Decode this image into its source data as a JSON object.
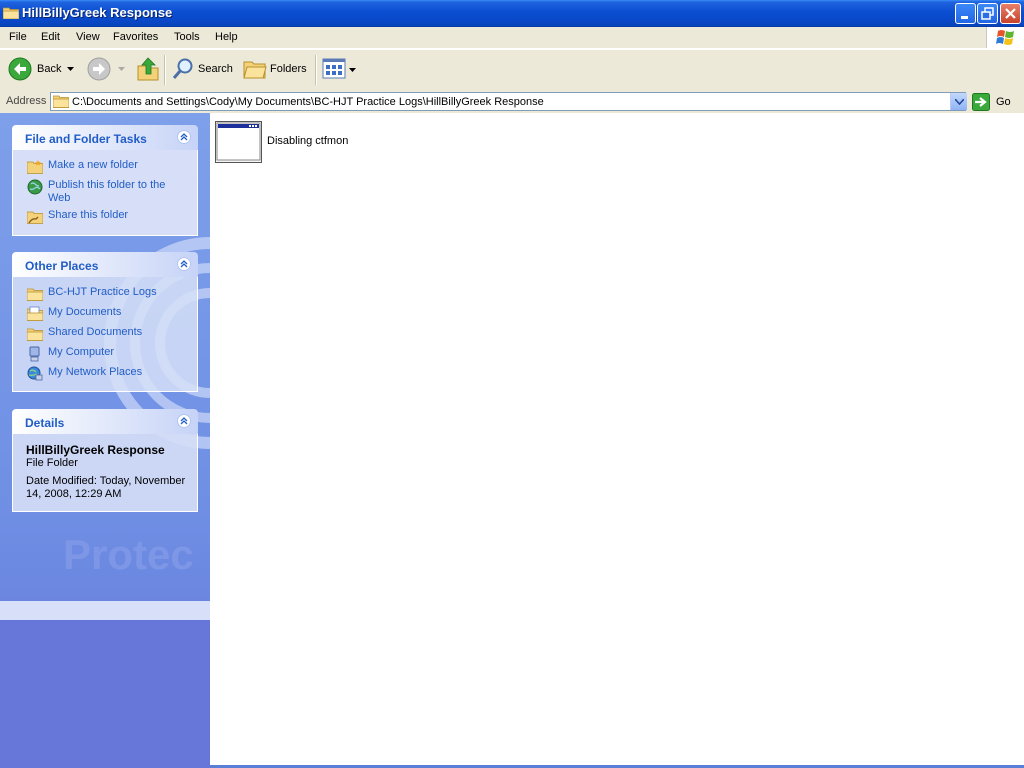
{
  "window": {
    "title": "HillBillyGreek Response"
  },
  "menu": [
    "File",
    "Edit",
    "View",
    "Favorites",
    "Tools",
    "Help"
  ],
  "toolbar": {
    "back_label": "Back",
    "search_label": "Search",
    "folders_label": "Folders"
  },
  "address": {
    "label": "Address",
    "path": "C:\\Documents and Settings\\Cody\\My Documents\\BC-HJT Practice Logs\\HillBillyGreek Response",
    "go_label": "Go"
  },
  "taskpane": {
    "file_tasks": {
      "title": "File and Folder Tasks",
      "items": [
        {
          "label": "Make a new folder",
          "icon": "new-folder-icon"
        },
        {
          "label": "Publish this folder to the Web",
          "icon": "globe-icon"
        },
        {
          "label": "Share this folder",
          "icon": "share-folder-icon"
        }
      ]
    },
    "other_places": {
      "title": "Other Places",
      "items": [
        {
          "label": "BC-HJT Practice Logs",
          "icon": "folder-icon"
        },
        {
          "label": "My Documents",
          "icon": "my-documents-icon"
        },
        {
          "label": "Shared Documents",
          "icon": "folder-icon"
        },
        {
          "label": "My Computer",
          "icon": "computer-icon"
        },
        {
          "label": "My Network Places",
          "icon": "network-icon"
        }
      ]
    },
    "details": {
      "title": "Details",
      "name": "HillBillyGreek Response",
      "type": "File Folder",
      "modified": "Date Modified: Today, November 14, 2008, 12:29 AM"
    },
    "watermark": "Protec"
  },
  "files": [
    {
      "name": "Disabling ctfmon",
      "icon": "window-thumbnail-icon"
    }
  ],
  "colors": {
    "titlebar": "#0b4ed2",
    "taskpane": "#6f8fe4",
    "link": "#215dc6"
  }
}
